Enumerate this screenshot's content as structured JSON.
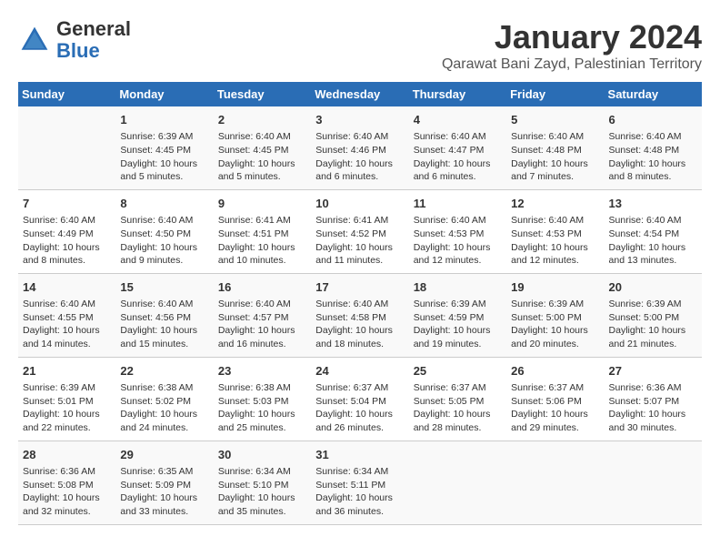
{
  "header": {
    "logo_line1": "General",
    "logo_line2": "Blue",
    "main_title": "January 2024",
    "subtitle": "Qarawat Bani Zayd, Palestinian Territory"
  },
  "calendar": {
    "days_of_week": [
      "Sunday",
      "Monday",
      "Tuesday",
      "Wednesday",
      "Thursday",
      "Friday",
      "Saturday"
    ],
    "weeks": [
      [
        {
          "day": "",
          "info": ""
        },
        {
          "day": "1",
          "info": "Sunrise: 6:39 AM\nSunset: 4:45 PM\nDaylight: 10 hours\nand 5 minutes."
        },
        {
          "day": "2",
          "info": "Sunrise: 6:40 AM\nSunset: 4:45 PM\nDaylight: 10 hours\nand 5 minutes."
        },
        {
          "day": "3",
          "info": "Sunrise: 6:40 AM\nSunset: 4:46 PM\nDaylight: 10 hours\nand 6 minutes."
        },
        {
          "day": "4",
          "info": "Sunrise: 6:40 AM\nSunset: 4:47 PM\nDaylight: 10 hours\nand 6 minutes."
        },
        {
          "day": "5",
          "info": "Sunrise: 6:40 AM\nSunset: 4:48 PM\nDaylight: 10 hours\nand 7 minutes."
        },
        {
          "day": "6",
          "info": "Sunrise: 6:40 AM\nSunset: 4:48 PM\nDaylight: 10 hours\nand 8 minutes."
        }
      ],
      [
        {
          "day": "7",
          "info": "Sunrise: 6:40 AM\nSunset: 4:49 PM\nDaylight: 10 hours\nand 8 minutes."
        },
        {
          "day": "8",
          "info": "Sunrise: 6:40 AM\nSunset: 4:50 PM\nDaylight: 10 hours\nand 9 minutes."
        },
        {
          "day": "9",
          "info": "Sunrise: 6:41 AM\nSunset: 4:51 PM\nDaylight: 10 hours\nand 10 minutes."
        },
        {
          "day": "10",
          "info": "Sunrise: 6:41 AM\nSunset: 4:52 PM\nDaylight: 10 hours\nand 11 minutes."
        },
        {
          "day": "11",
          "info": "Sunrise: 6:40 AM\nSunset: 4:53 PM\nDaylight: 10 hours\nand 12 minutes."
        },
        {
          "day": "12",
          "info": "Sunrise: 6:40 AM\nSunset: 4:53 PM\nDaylight: 10 hours\nand 12 minutes."
        },
        {
          "day": "13",
          "info": "Sunrise: 6:40 AM\nSunset: 4:54 PM\nDaylight: 10 hours\nand 13 minutes."
        }
      ],
      [
        {
          "day": "14",
          "info": "Sunrise: 6:40 AM\nSunset: 4:55 PM\nDaylight: 10 hours\nand 14 minutes."
        },
        {
          "day": "15",
          "info": "Sunrise: 6:40 AM\nSunset: 4:56 PM\nDaylight: 10 hours\nand 15 minutes."
        },
        {
          "day": "16",
          "info": "Sunrise: 6:40 AM\nSunset: 4:57 PM\nDaylight: 10 hours\nand 16 minutes."
        },
        {
          "day": "17",
          "info": "Sunrise: 6:40 AM\nSunset: 4:58 PM\nDaylight: 10 hours\nand 18 minutes."
        },
        {
          "day": "18",
          "info": "Sunrise: 6:39 AM\nSunset: 4:59 PM\nDaylight: 10 hours\nand 19 minutes."
        },
        {
          "day": "19",
          "info": "Sunrise: 6:39 AM\nSunset: 5:00 PM\nDaylight: 10 hours\nand 20 minutes."
        },
        {
          "day": "20",
          "info": "Sunrise: 6:39 AM\nSunset: 5:00 PM\nDaylight: 10 hours\nand 21 minutes."
        }
      ],
      [
        {
          "day": "21",
          "info": "Sunrise: 6:39 AM\nSunset: 5:01 PM\nDaylight: 10 hours\nand 22 minutes."
        },
        {
          "day": "22",
          "info": "Sunrise: 6:38 AM\nSunset: 5:02 PM\nDaylight: 10 hours\nand 24 minutes."
        },
        {
          "day": "23",
          "info": "Sunrise: 6:38 AM\nSunset: 5:03 PM\nDaylight: 10 hours\nand 25 minutes."
        },
        {
          "day": "24",
          "info": "Sunrise: 6:37 AM\nSunset: 5:04 PM\nDaylight: 10 hours\nand 26 minutes."
        },
        {
          "day": "25",
          "info": "Sunrise: 6:37 AM\nSunset: 5:05 PM\nDaylight: 10 hours\nand 28 minutes."
        },
        {
          "day": "26",
          "info": "Sunrise: 6:37 AM\nSunset: 5:06 PM\nDaylight: 10 hours\nand 29 minutes."
        },
        {
          "day": "27",
          "info": "Sunrise: 6:36 AM\nSunset: 5:07 PM\nDaylight: 10 hours\nand 30 minutes."
        }
      ],
      [
        {
          "day": "28",
          "info": "Sunrise: 6:36 AM\nSunset: 5:08 PM\nDaylight: 10 hours\nand 32 minutes."
        },
        {
          "day": "29",
          "info": "Sunrise: 6:35 AM\nSunset: 5:09 PM\nDaylight: 10 hours\nand 33 minutes."
        },
        {
          "day": "30",
          "info": "Sunrise: 6:34 AM\nSunset: 5:10 PM\nDaylight: 10 hours\nand 35 minutes."
        },
        {
          "day": "31",
          "info": "Sunrise: 6:34 AM\nSunset: 5:11 PM\nDaylight: 10 hours\nand 36 minutes."
        },
        {
          "day": "",
          "info": ""
        },
        {
          "day": "",
          "info": ""
        },
        {
          "day": "",
          "info": ""
        }
      ]
    ]
  }
}
